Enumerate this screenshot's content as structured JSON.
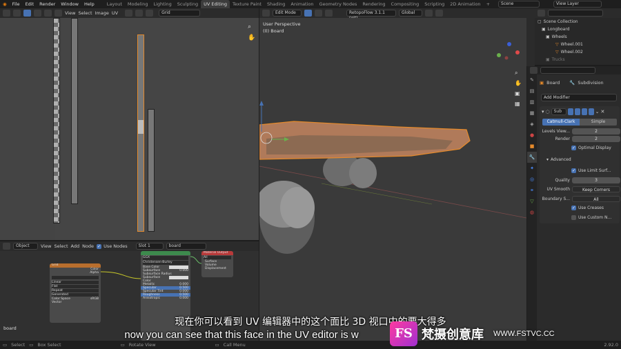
{
  "menu": [
    "File",
    "Edit",
    "Render",
    "Window",
    "Help"
  ],
  "workspaces": [
    "Layout",
    "Modeling",
    "Sculpting",
    "UV Editing",
    "Texture Paint",
    "Shading",
    "Animation",
    "Geometry Nodes",
    "Rendering",
    "Compositing",
    "Scripting",
    "2D Animation"
  ],
  "workspaces_labels": {
    "lighting": "Lighting"
  },
  "scene": "Scene",
  "view_layer": "View Layer",
  "uv_header": {
    "view": "View",
    "select": "Select",
    "image": "Image",
    "uv": "UV",
    "grid": "Grid"
  },
  "v3d_header": {
    "mode": "Edit Mode",
    "addon": "RetopoFlow 3.1.1 (git)",
    "orient": "Global"
  },
  "viewport": {
    "perspective": "User Perspective",
    "object": "(0) Board"
  },
  "outliner": {
    "items": [
      "Scene Collection",
      "Longboard",
      "Wheels",
      "Wheel.001",
      "Wheel.002",
      "Trucks"
    ]
  },
  "props": {
    "object": "Board",
    "modifier_name": "Subdivision",
    "add_modifier": "Add Modifier",
    "sub_short": "Sub",
    "catmull": "Catmull-Clark",
    "simple": "Simple",
    "levels_label": "Levels View...",
    "levels_val": "2",
    "render_label": "Render",
    "render_val": "2",
    "optimal": "Optimal Display",
    "advanced": "Advanced",
    "limit": "Use Limit Surf...",
    "quality_label": "Quality",
    "quality_val": "3",
    "uvsmooth_label": "UV Smooth",
    "uvsmooth_val": "Keep Corners",
    "boundary_label": "Boundary S...",
    "boundary_val": "All",
    "creases": "Use Creases",
    "custom": "Use Custom N..."
  },
  "node_header": {
    "object": "Object",
    "view": "View",
    "select": "Select",
    "add": "Add",
    "node": "Node",
    "use_nodes": "Use Nodes",
    "slot": "Slot 1",
    "material": "board"
  },
  "node_label": "board",
  "nodes": {
    "tex": {
      "title": "Grid",
      "rows": [
        "Color",
        "Alpha",
        "Linear",
        "Flat",
        "Repeat",
        "Generated",
        "Color Space",
        "Vector"
      ],
      "cs_val": "sRGB"
    },
    "bsdf": {
      "rows": [
        "GGX",
        "Christensen-Burley",
        "Base Color",
        "Subsurface",
        "Subsurface Radius",
        "Subsurface Color",
        "Metallic",
        "Specular",
        "Specular Tint",
        "Roughness",
        "Anisotropic"
      ],
      "vals": [
        "",
        "",
        "",
        "0.000",
        "",
        "",
        "0.000",
        "0.500",
        "0.000",
        "0.500",
        "0.000"
      ]
    },
    "out": {
      "title": "Material Output",
      "rows": [
        "All",
        "Surface",
        "Volume",
        "Displacement"
      ]
    }
  },
  "status": {
    "select": "Select",
    "box": "Box Select",
    "rotate": "Rotate View",
    "call": "Call Menu",
    "version": "2.92.0"
  },
  "subtitle_cn": "现在你可以看到 UV 编辑器中的这个面比 3D 视口中的要大得多",
  "subtitle_en": "now you can see that this face in the UV editor is w",
  "watermark": {
    "fs": "FS",
    "cn": "梵摄创意库",
    "url": "WWW.FSTVC.CC"
  },
  "colors": {
    "accent": "#4772b3",
    "select_orange": "#e58a2b"
  }
}
